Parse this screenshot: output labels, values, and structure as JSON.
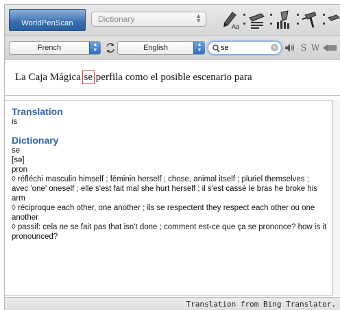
{
  "app": {
    "logo_text": "WorldPenScan"
  },
  "toolbar": {
    "mode": "Dictionary",
    "tools": [
      {
        "icon": "font-size-pen-icon"
      },
      {
        "icon": "scan-pen-icon"
      },
      {
        "icon": "scan-line-icon"
      },
      {
        "icon": "cursor-pen-icon"
      }
    ]
  },
  "languages": {
    "source": "French",
    "target": "English"
  },
  "search": {
    "value": "se"
  },
  "sentence": {
    "before": "La Caja Mágica ",
    "highlight": "se",
    "after": " perfila como el posible escenario para"
  },
  "translation": {
    "heading": "Translation",
    "text": "is"
  },
  "dictionary": {
    "heading": "Dictionary",
    "word": "se",
    "pronunciation": "[sə]",
    "pos": "pron",
    "entries": [
      "◊ réfléchi masculin himself ; féminin herself ; chose, animal itself ; pluriel themselves ; avec 'one' oneself ; elle s'est fait mal she hurt herself ; il s'est cassé le bras he broke his arm",
      "◊ réciproque each other, one another ; ils se respectent they respect each other ou one another",
      "◊ passif: cela ne se fait pas that isn't done ; comment est-ce que ça se prononce? how is it pronounced?"
    ]
  },
  "footer": {
    "text": "Translation from Bing Translator."
  },
  "colors": {
    "accent": "#2f63a5",
    "highlight_border": "#e03c3c",
    "logo_bg": "#2b5f9e"
  }
}
